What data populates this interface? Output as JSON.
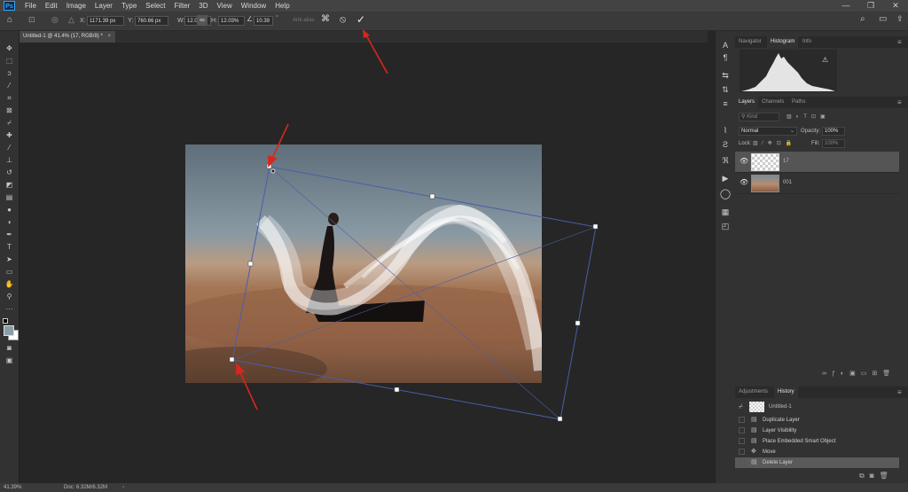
{
  "app": {
    "logo": "Ps"
  },
  "menu": [
    "File",
    "Edit",
    "Image",
    "Layer",
    "Type",
    "Select",
    "Filter",
    "3D",
    "View",
    "Window",
    "Help"
  ],
  "window_controls": {
    "minimize": "—",
    "restore": "❐",
    "close": "✕"
  },
  "options": {
    "x_label": "X:",
    "x_value": "1171.39 px",
    "y_label": "Y:",
    "y_value": "760.66 px",
    "w_label": "W:",
    "w_value": "12.03%",
    "h_label": "H:",
    "h_value": "12.03%",
    "angle_value": "10.39",
    "anti_alias": "Anti-alias"
  },
  "document_tab": "Untitled-1 @ 41.4% (17, RGB/8) *",
  "panels": {
    "top_tabs": [
      "Navigator",
      "Histogram",
      "Info"
    ],
    "top_active": "Histogram",
    "layers_tabs": [
      "Layers",
      "Channels",
      "Paths"
    ],
    "layers_active": "Layers",
    "kind_placeholder": "Kind",
    "blend_mode": "Normal",
    "opacity_label": "Opacity:",
    "opacity_value": "100%",
    "lock_label": "Lock:",
    "fill_label": "Fill:",
    "fill_value": "100%",
    "layers": [
      {
        "name": "17"
      },
      {
        "name": "001"
      }
    ],
    "history_tabs": [
      "Adjustments",
      "History"
    ],
    "history_active": "History",
    "history_snapshot": "Untitled-1",
    "history_items": [
      "Duplicate Layer",
      "Layer Visibility",
      "Place Embedded Smart Object",
      "Move",
      "Delete Layer"
    ]
  },
  "status": {
    "zoom": "41.39%",
    "doc": "Doc: 6.32M/6.32M"
  },
  "colors": {
    "accent": "#1473e6",
    "arrow": "#d9261c",
    "transform_box": "#3b4f9c"
  }
}
